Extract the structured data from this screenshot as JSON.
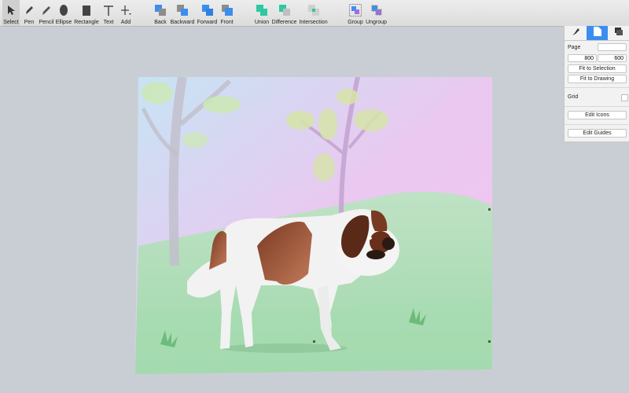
{
  "toolbar": {
    "tools": [
      {
        "label": "Select",
        "icon": "arrow-cursor-icon"
      },
      {
        "label": "Pen",
        "icon": "pen-icon"
      },
      {
        "label": "Pencil",
        "icon": "pencil-icon"
      },
      {
        "label": "Ellipse",
        "icon": "ellipse-icon"
      },
      {
        "label": "Rectangle",
        "icon": "rectangle-icon"
      },
      {
        "label": "Text",
        "icon": "text-icon"
      },
      {
        "label": "Add",
        "icon": "plus-icon"
      },
      {
        "label": "Back",
        "icon": "send-back-icon"
      },
      {
        "label": "Backward",
        "icon": "send-backward-icon"
      },
      {
        "label": "Forward",
        "icon": "bring-forward-icon"
      },
      {
        "label": "Front",
        "icon": "bring-front-icon"
      },
      {
        "label": "Union",
        "icon": "union-icon"
      },
      {
        "label": "Difference",
        "icon": "difference-icon"
      },
      {
        "label": "Intersection",
        "icon": "intersection-icon"
      },
      {
        "label": "Group",
        "icon": "group-icon"
      },
      {
        "label": "Ungroup",
        "icon": "ungroup-icon"
      }
    ]
  },
  "inspector": {
    "tabs": [
      "brush-icon",
      "document-icon",
      "layers-icon"
    ],
    "page_label": "Page",
    "page_name": "",
    "width": "800",
    "height": "600",
    "fit_selection": "Fit to Selection",
    "fit_drawing": "Fit to Drawing",
    "grid_label": "Grid",
    "edit_icons": "Edit Icons",
    "edit_guides": "Edit Guides"
  },
  "colors": {
    "accent": "#3b8ef0",
    "canvas_bg": "#c9ced5"
  }
}
